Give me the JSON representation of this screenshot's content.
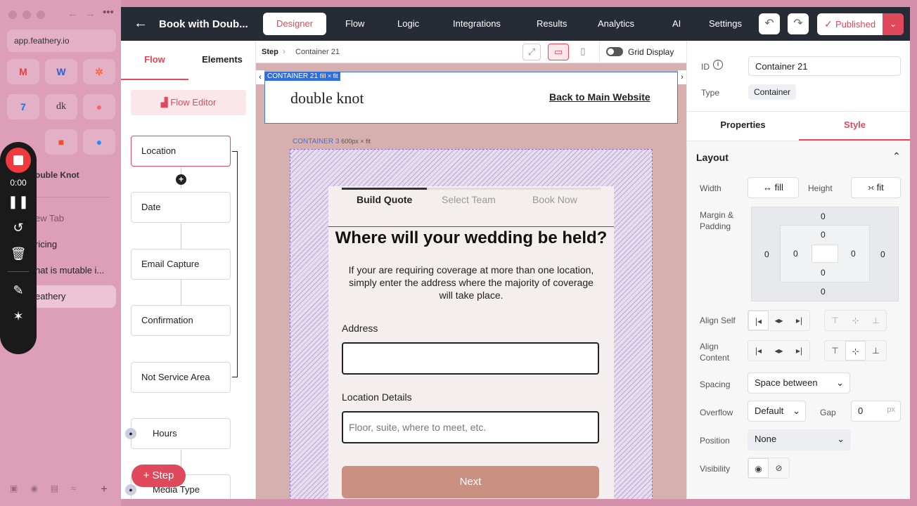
{
  "browser": {
    "url": "app.feathery.io",
    "favicons": [
      "gmail-icon",
      "word-icon",
      "hubspot-icon",
      "calendar-icon",
      "dk-icon",
      "asana-icon",
      "feathery-icon",
      "office-icon",
      "bubble-icon"
    ],
    "dk_label": "dk",
    "group_label": "ouble Knot",
    "tabs": [
      "ew Tab",
      "ricing",
      "hat is mutable i...",
      "eathery"
    ],
    "recorder_time": "0:00"
  },
  "topbar": {
    "title": "Book with Doub...",
    "nav": [
      "Designer",
      "Flow",
      "Logic",
      "Integrations",
      "Results",
      "Analytics",
      "AI",
      "Settings"
    ],
    "published_label": "Published"
  },
  "left_panel": {
    "tabs": [
      "Flow",
      "Elements"
    ],
    "flow_editor_label": "Flow Editor",
    "nodes": [
      "Location",
      "Date",
      "Email Capture",
      "Confirmation",
      "Not Service Area",
      "Hours",
      "Media Type"
    ],
    "add_step_label": "Step"
  },
  "canvas": {
    "breadcrumb_step": "Step",
    "breadcrumb_container": "Container 21",
    "grid_display_label": "Grid Display",
    "container21_tag": "CONTAINER 21",
    "container21_size": "fill × fit",
    "container3_tag": "CONTAINER 3",
    "container3_size": "600px × fit",
    "logo": "double knot",
    "back_link": "Back to Main Website",
    "progress_tabs": [
      "Build Quote",
      "Select Team",
      "Book Now"
    ],
    "question": "Where will your wedding be held?",
    "description": "If your are requiring coverage at more than one location, simply enter the address where the majority of coverage will take place.",
    "address_label": "Address",
    "address_placeholder": "",
    "location_label": "Location Details",
    "location_placeholder": "Floor, suite, where to meet, etc.",
    "next_label": "Next",
    "accent": "#c98f80"
  },
  "right_panel": {
    "id_label": "ID",
    "id_value": "Container 21",
    "type_label": "Type",
    "type_value": "Container",
    "tabs": [
      "Properties",
      "Style"
    ],
    "section_title": "Layout",
    "width_label": "Width",
    "width_value": "fill",
    "height_label": "Height",
    "height_value": "fit",
    "margin_label": "Margin & Padding",
    "margin_values": {
      "top": "0",
      "right": "0",
      "bottom": "0",
      "left": "0"
    },
    "padding_values": {
      "top": "0",
      "right": "0",
      "bottom": "0",
      "left": "0"
    },
    "align_self_label": "Align Self",
    "align_content_label": "Align Content",
    "spacing_label": "Spacing",
    "spacing_value": "Space between",
    "overflow_label": "Overflow",
    "overflow_value": "Default",
    "gap_label": "Gap",
    "gap_value": "0",
    "gap_unit": "px",
    "position_label": "Position",
    "position_value": "None",
    "visibility_label": "Visibility"
  },
  "colors": {
    "brand": "#e0485c",
    "topbar": "#262b35"
  }
}
